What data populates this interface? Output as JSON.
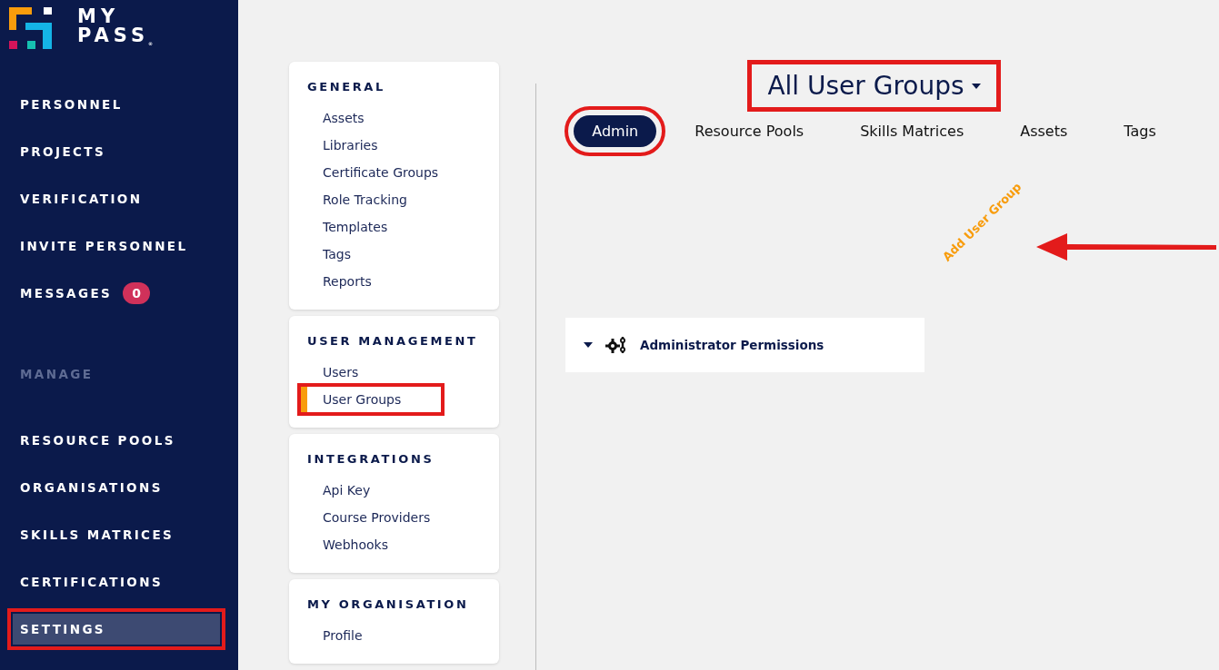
{
  "brand": {
    "line_1": "MY",
    "line_2": "PASS",
    "mark": "®"
  },
  "nav": {
    "items": [
      {
        "label": "PERSONNEL",
        "selected": false,
        "highlighted": false
      },
      {
        "label": "PROJECTS",
        "selected": false,
        "highlighted": false
      },
      {
        "label": "VERIFICATION",
        "selected": false,
        "highlighted": false
      },
      {
        "label": "INVITE PERSONNEL",
        "selected": false,
        "highlighted": false
      },
      {
        "label": "MESSAGES",
        "badge": "0",
        "selected": false,
        "highlighted": false
      }
    ],
    "section": "MANAGE",
    "manage_items": [
      {
        "label": "RESOURCE POOLS",
        "selected": false,
        "highlighted": false
      },
      {
        "label": "ORGANISATIONS",
        "selected": false,
        "highlighted": false
      },
      {
        "label": "SKILLS MATRICES",
        "selected": false,
        "highlighted": false
      },
      {
        "label": "CERTIFICATIONS",
        "selected": false,
        "highlighted": false
      },
      {
        "label": "SETTINGS",
        "selected": true,
        "highlighted": true
      }
    ]
  },
  "settings_menu": [
    {
      "heading": "GENERAL",
      "items": [
        {
          "label": "Assets",
          "selected": false,
          "highlighted": false
        },
        {
          "label": "Libraries",
          "selected": false,
          "highlighted": false
        },
        {
          "label": "Certificate Groups",
          "selected": false,
          "highlighted": false
        },
        {
          "label": "Role Tracking",
          "selected": false,
          "highlighted": false
        },
        {
          "label": "Templates",
          "selected": false,
          "highlighted": false
        },
        {
          "label": "Tags",
          "selected": false,
          "highlighted": false
        },
        {
          "label": "Reports",
          "selected": false,
          "highlighted": false
        }
      ]
    },
    {
      "heading": "USER MANAGEMENT",
      "items": [
        {
          "label": "Users",
          "selected": false,
          "highlighted": false
        },
        {
          "label": "User Groups",
          "selected": true,
          "highlighted": true
        }
      ]
    },
    {
      "heading": "INTEGRATIONS",
      "items": [
        {
          "label": "Api Key",
          "selected": false,
          "highlighted": false
        },
        {
          "label": "Course Providers",
          "selected": false,
          "highlighted": false
        },
        {
          "label": "Webhooks",
          "selected": false,
          "highlighted": false
        }
      ]
    },
    {
      "heading": "MY ORGANISATION",
      "items": [
        {
          "label": "Profile",
          "selected": false,
          "highlighted": false
        }
      ]
    }
  ],
  "main": {
    "title": {
      "text": "All User Groups",
      "highlighted": true
    },
    "tabs": [
      {
        "label": "Admin",
        "selected": true,
        "highlighted": true
      },
      {
        "label": "Resource Pools",
        "selected": false,
        "highlighted": false
      },
      {
        "label": "Skills Matrices",
        "selected": false,
        "highlighted": false
      },
      {
        "label": "Assets",
        "selected": false,
        "highlighted": false
      },
      {
        "label": "Tags",
        "selected": false,
        "highlighted": false
      }
    ],
    "add_link": "Add User Group",
    "groups": [
      {
        "name": "Administrator Permissions",
        "expanded": true
      }
    ]
  }
}
